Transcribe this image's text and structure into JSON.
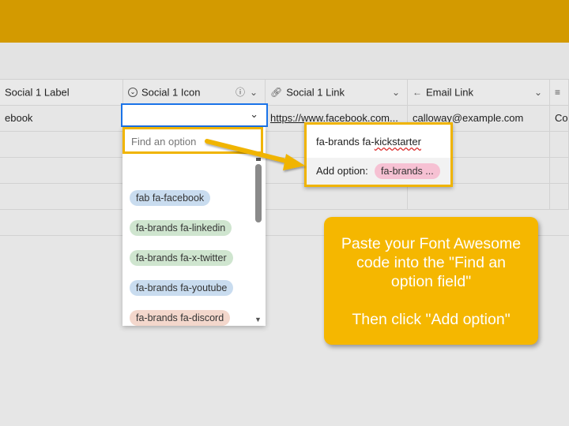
{
  "columns": [
    {
      "label": "Social 1 Label",
      "icon": "text-lines-icon"
    },
    {
      "label": "Social 1 Icon",
      "icon": "single-select-icon",
      "info_icon": "info-icon"
    },
    {
      "label": "Social 1 Link",
      "icon": "link-icon"
    },
    {
      "label": "Email Link",
      "icon": "email-icon"
    },
    {
      "label": "",
      "icon": "text-lines-icon"
    }
  ],
  "rows": [
    {
      "label": "ebook",
      "link": "https://www.facebook.com...",
      "email": "calloway@example.com",
      "extra": "Co"
    }
  ],
  "dropdown": {
    "placeholder": "Find an option",
    "options": [
      {
        "label": "fab fa-facebook",
        "color": "#c9dcef"
      },
      {
        "label": "fa-brands fa-linkedin",
        "color": "#cfe5cf"
      },
      {
        "label": "fa-brands fa-x-twitter",
        "color": "#cfe5cf"
      },
      {
        "label": "fa-brands fa-youtube",
        "color": "#c9dcef"
      },
      {
        "label": "fa-brands fa-discord",
        "color": "#f3d7cc"
      }
    ]
  },
  "popup": {
    "typed_prefix": "fa-brands fa-",
    "typed_underlined": "kickstarter",
    "add_label": "Add option:",
    "new_option": "fa-brands ..."
  },
  "callout": {
    "line1": "Paste your Font Awesome code into the \"Find an option field\"",
    "line2": "Then click \"Add option\""
  },
  "colors": {
    "topbar": "#d39a00",
    "highlight": "#f0b400",
    "callout_bg": "#f5b700"
  }
}
